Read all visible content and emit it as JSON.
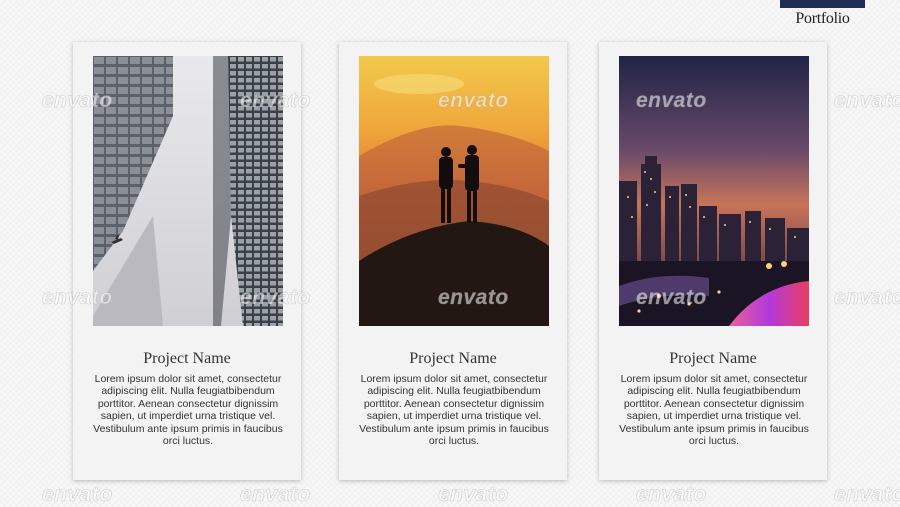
{
  "section": {
    "title": "Portfolio"
  },
  "cards": [
    {
      "name": "Project Name",
      "image": "skyscrapers-photo",
      "description": "Lorem ipsum dolor sit amet, consectetur adipiscing elit. Nulla feugiatbibendum porttitor. Aenean consectetur dignissim sapien, ut imperdiet urna tristique vel. Vestibulum ante ipsum primis in faucibus orci luctus."
    },
    {
      "name": "Project Name",
      "image": "sunset-couple-photo",
      "description": "Lorem ipsum dolor sit amet, consectetur adipiscing elit. Nulla feugiatbibendum porttitor. Aenean consectetur dignissim sapien, ut imperdiet urna tristique vel. Vestibulum ante ipsum primis in faucibus orci luctus."
    },
    {
      "name": "Project Name",
      "image": "city-night-photo",
      "description": "Lorem ipsum dolor sit amet, consectetur adipiscing elit. Nulla feugiatbibendum porttitor. Aenean consectetur dignissim sapien, ut imperdiet urna tristique vel. Vestibulum ante ipsum primis in faucibus orci luctus."
    }
  ],
  "watermark": {
    "text": "envato"
  },
  "colors": {
    "header_bar": "#1f2d55",
    "card_bg": "#f3f3f3",
    "text": "#333333"
  }
}
